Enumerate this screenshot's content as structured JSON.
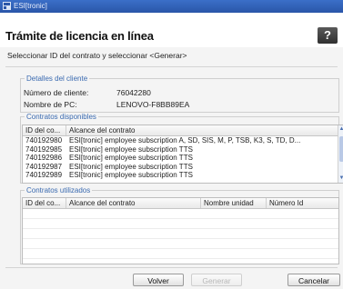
{
  "window": {
    "title": "ESI[tronic]"
  },
  "header": {
    "title": "Trámite de licencia en línea",
    "help_label": "?"
  },
  "instruction": "Seleccionar ID del contrato y seleccionar <Generar>",
  "client_details": {
    "legend": "Detalles del cliente",
    "client_number_label": "Número de cliente:",
    "client_number_value": "76042280",
    "pc_name_label": "Nombre de PC:",
    "pc_name_value": "LENOVO-F8BB89EA"
  },
  "available_contracts": {
    "legend": "Contratos disponibles",
    "columns": [
      "ID del co...",
      "Alcance del contrato"
    ],
    "rows": [
      {
        "id": "740192980",
        "scope": "ESI[tronic] employee subscription A, SD, SIS, M, P, TSB, K3, S, TD, D..."
      },
      {
        "id": "740192985",
        "scope": "ESI[tronic] employee subscription TTS"
      },
      {
        "id": "740192986",
        "scope": "ESI[tronic] employee subscription TTS"
      },
      {
        "id": "740192987",
        "scope": "ESI[tronic] employee subscription TTS"
      },
      {
        "id": "740192989",
        "scope": "ESI[tronic] employee subscription TTS"
      }
    ]
  },
  "used_contracts": {
    "legend": "Contratos utilizados",
    "columns": [
      "ID del co...",
      "Alcance del contrato",
      "Nombre unidad",
      "Número Id"
    ]
  },
  "buttons": {
    "back": "Volver",
    "generate": "Generar",
    "cancel": "Cancelar"
  }
}
